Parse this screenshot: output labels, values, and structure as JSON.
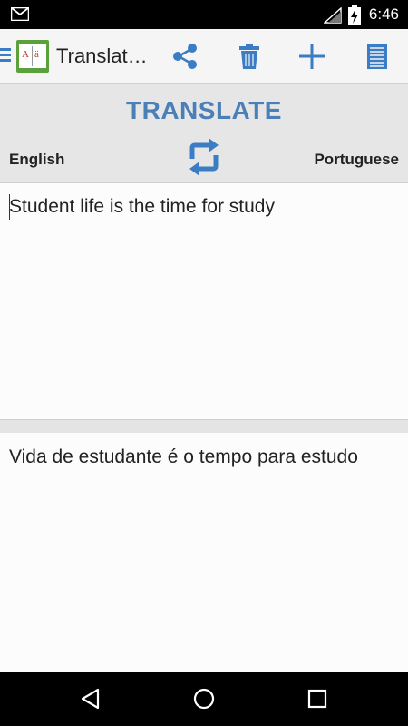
{
  "status_bar": {
    "time": "6:46"
  },
  "action_bar": {
    "title": "Translat…"
  },
  "translate": {
    "button_label": "TRANSLATE",
    "source_language": "English",
    "target_language": "Portuguese"
  },
  "input": {
    "text": "Student life is the time for study"
  },
  "output": {
    "text": "Vida de estudante é o tempo para estudo"
  },
  "colors": {
    "accent": "#3b7dc4",
    "logo": "#5aa13b"
  }
}
